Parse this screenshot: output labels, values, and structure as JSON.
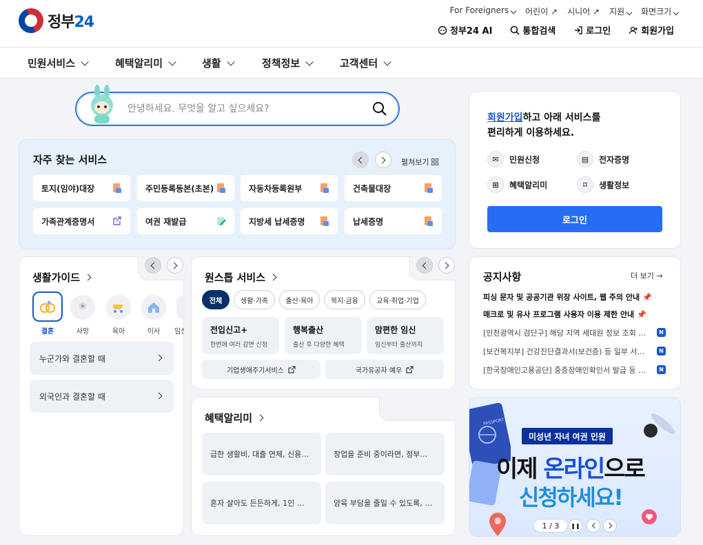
{
  "header": {
    "logo_text": "정부",
    "logo_num": "24",
    "util_links": [
      "For Foreigners",
      "어린이",
      "시니어",
      "지원",
      "화면크기"
    ],
    "main_links": [
      "정부24 AI",
      "통합검색",
      "로그인",
      "회원가입"
    ]
  },
  "gnb": [
    "민원서비스",
    "혜택알리미",
    "생활",
    "정책정보",
    "고객센터"
  ],
  "search": {
    "placeholder": "안녕하세요. 무엇을 알고 싶으세요?"
  },
  "frequent": {
    "title": "자주 찾는 서비스",
    "expand_label": "펼쳐보기",
    "items": [
      "토지(임야)대장",
      "주민등록등본(초본)",
      "자동차등록원부",
      "건축물대장",
      "가족관계증명서",
      "여권 재발급",
      "지방세 납세증명",
      "납세증명"
    ]
  },
  "login_card": {
    "link": "회원가입",
    "text1": "하고 아래 서비스를",
    "text2": "편리하게 이용하세요.",
    "services": [
      "민원신청",
      "전자증명",
      "혜택알리미",
      "생활정보"
    ],
    "button": "로그인"
  },
  "life_guide": {
    "title": "생활가이드",
    "chips": [
      "결혼",
      "사망",
      "육아",
      "이사",
      "임신"
    ],
    "rows": [
      "누군가와 결혼할 때",
      "외국인과 결혼할 때"
    ]
  },
  "onestop": {
    "title": "원스톱 서비스",
    "pills": [
      "전체",
      "생활·가족",
      "출산·육아",
      "복지·금융",
      "교육·취업·기업"
    ],
    "boxes": [
      {
        "title": "전입신고+",
        "sub": "한번에 여러 감면 신청"
      },
      {
        "title": "행복출산",
        "sub": "출산 후 다양한 혜택"
      },
      {
        "title": "맘편한 임신",
        "sub": "임신부터 출산까지"
      }
    ],
    "links": [
      "기업생애주기서비스",
      "국가유공자 예우"
    ]
  },
  "benefit": {
    "title": "혜택알리미",
    "items": [
      "급한 생활비, 대출 연체, 신용…",
      "창업을 준비 중이라면, 정부…",
      "혼자 살아도 든든하게, 1인 …",
      "양육 부담을 줄일 수 있도록, …"
    ]
  },
  "notice": {
    "title": "공지사항",
    "more": "더 보기",
    "pinned": [
      "피싱 문자 및 공공기관 위장 사이트, 웹 주의 안내",
      "매크로 및 유사 프로그램 사용자 이용 제한 안내"
    ],
    "items": [
      "[인천광역시 검단구] 해당 지역 세대원 정보 조회 …",
      "[보건복지부] 건강진단결과서(보건증) 등 일부 서…",
      "[한국장애인고용공단] 중증장애인확인서 발급 등 …"
    ],
    "badge": "N"
  },
  "banner": {
    "tag": "미성년 자녀 여권 민원",
    "line1_a": "이제 ",
    "line1_b": "온라인",
    "line1_c": "으로",
    "line2": "신청하세요!",
    "passport": "PASSPORT",
    "page": "1 / 3"
  },
  "colors": {
    "primary": "#256ef4",
    "navy": "#0b2f6b",
    "bg": "#f2f4f8"
  }
}
